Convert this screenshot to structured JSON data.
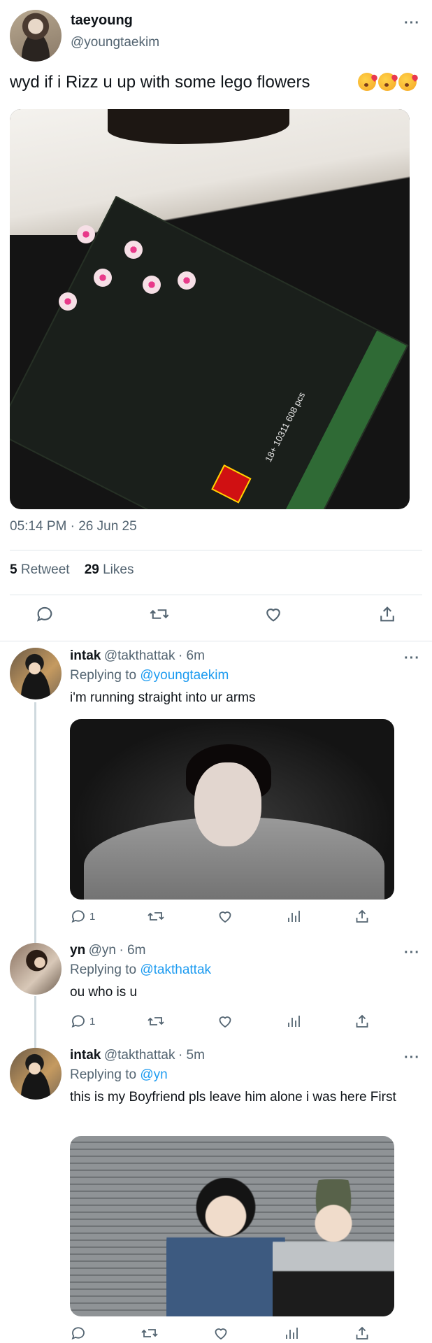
{
  "main_tweet": {
    "display_name": "taeyoung",
    "handle": "@youngtaekim",
    "text": "wyd if i Rizz u up with some lego flowers",
    "emojis": [
      "face-blowing-kiss",
      "face-blowing-kiss",
      "face-blowing-kiss"
    ],
    "photo_alt": "LEGO orchid box on a dark floor",
    "box_text": "18+ 10311 608 pcs",
    "timestamp": "05:14 PM · 26 Jun 25",
    "retweets_count": "5",
    "retweets_label": "Retweet",
    "likes_count": "29",
    "likes_label": "Likes"
  },
  "replies": [
    {
      "display_name": "intak",
      "handle": "@takthattak",
      "time": "· 6m",
      "replying_prefix": "Replying to",
      "replying_to": "@youngtaekim",
      "text": "i'm running straight into ur arms",
      "reply_count": "1"
    },
    {
      "display_name": "yn",
      "handle": "@yn",
      "time": "· 6m",
      "replying_prefix": "Replying to",
      "replying_to": "@takthattak",
      "text": "ou who is u",
      "reply_count": "1"
    },
    {
      "display_name": "intak",
      "handle": "@takthattak",
      "time": "· 5m",
      "replying_prefix": "Replying to",
      "replying_to": "@yn",
      "text": "this is my Boyfriend pls leave him alone i was here First",
      "reply_count": ""
    }
  ],
  "colors": {
    "link": "#1d9bf0",
    "secondary_text": "#536471",
    "divider": "#e1e6ea",
    "lego_red": "#d01012"
  }
}
